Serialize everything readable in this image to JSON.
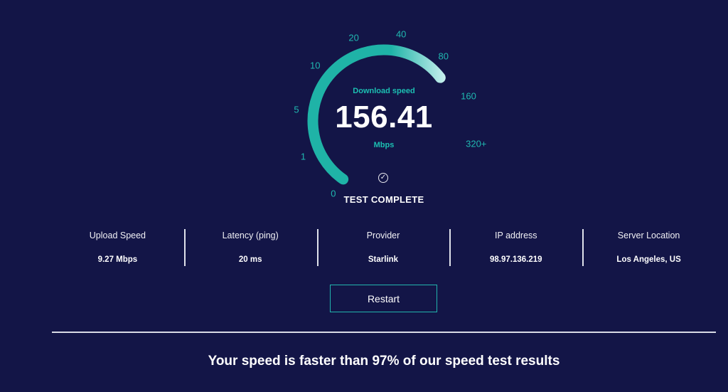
{
  "gauge": {
    "title": "Download speed",
    "value": "156.41",
    "unit": "Mbps",
    "status": "TEST COMPLETE",
    "ticks": [
      "0",
      "1",
      "5",
      "10",
      "20",
      "40",
      "80",
      "160",
      "320+"
    ],
    "fill_fraction": 0.79,
    "colors": {
      "track": "#1fb3a7",
      "fill_end": "#e6fbfb",
      "ticks": "#20b8b0"
    }
  },
  "stats": [
    {
      "label": "Upload Speed",
      "value": "9.27 Mbps"
    },
    {
      "label": "Latency (ping)",
      "value": "20 ms"
    },
    {
      "label": "Provider",
      "value": "Starlink"
    },
    {
      "label": "IP address",
      "value": "98.97.136.219"
    },
    {
      "label": "Server Location",
      "value": "Los Angeles, US"
    }
  ],
  "restart_label": "Restart",
  "headline": "Your speed is faster than 97% of our speed test results",
  "colors": {
    "background": "#131547",
    "accent": "#21b4ad"
  }
}
